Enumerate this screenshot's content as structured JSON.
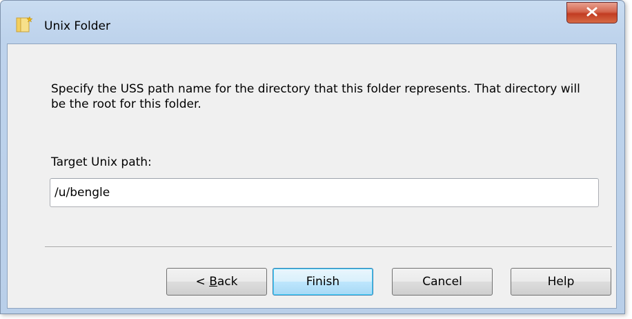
{
  "window": {
    "title": "Unix Folder",
    "icon": "folder-icon",
    "close_icon": "close-icon"
  },
  "content": {
    "description": "Specify the USS path name for the directory that this folder represents.  That directory will be the root for this folder.",
    "path_label": "Target Unix path:",
    "path_value": "/u/bengle"
  },
  "buttons": {
    "back_prefix": "< ",
    "back_mnemonic": "B",
    "back_rest": "ack",
    "finish": "Finish",
    "cancel": "Cancel",
    "help": "Help"
  },
  "colors": {
    "frame": "#bed3ec",
    "close_button": "#c23c22",
    "default_button_border": "#3c7fb1"
  }
}
